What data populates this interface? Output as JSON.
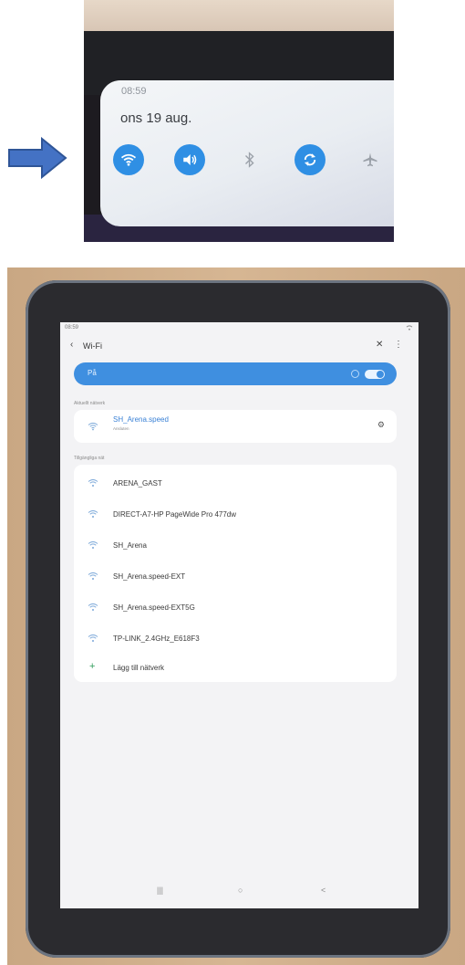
{
  "colors": {
    "accent": "#2f8fe4",
    "toggle_bar": "#3f8fe0",
    "arrow": "#4472c4",
    "add_plus": "#2f9c5a"
  },
  "quick_panel": {
    "time": "08:59",
    "date": "ons 19 aug.",
    "toggles": [
      {
        "icon": "wifi-icon",
        "on": true
      },
      {
        "icon": "sound-icon",
        "on": true
      },
      {
        "icon": "bluetooth-icon",
        "on": false
      },
      {
        "icon": "autorotate-icon",
        "on": true
      },
      {
        "icon": "airplane-icon",
        "on": false
      }
    ]
  },
  "tablet": {
    "status_time": "08:59",
    "header": {
      "title": "Wi-Fi"
    },
    "toggle": {
      "label": "På",
      "on": true
    },
    "current_section": "Aktuellt nätverk",
    "current_network": {
      "name": "SH_Arena.speed",
      "status": "Ansluten"
    },
    "available_section": "Tillgängliga nät",
    "networks": [
      "ARENA_GAST",
      "DIRECT-A7-HP PageWide Pro 477dw",
      "SH_Arena",
      "SH_Arena.speed-EXT",
      "SH_Arena.speed-EXT5G",
      "TP-LINK_2.4GHz_E618F3"
    ],
    "add_network": "Lägg till nätverk",
    "nav": {
      "recent": "|||",
      "home": "○",
      "back": "<"
    }
  }
}
